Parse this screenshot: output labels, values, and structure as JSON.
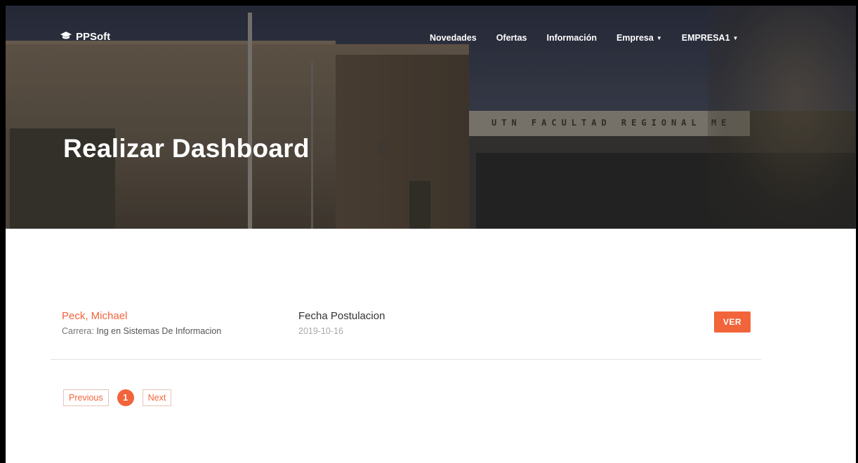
{
  "brand": {
    "name": "PPSoft",
    "icon": "graduation-cap-icon"
  },
  "nav": {
    "items": [
      {
        "label": "Novedades"
      },
      {
        "label": "Ofertas"
      },
      {
        "label": "Información"
      },
      {
        "label": "Empresa",
        "dropdown": true
      },
      {
        "label": "EMPRESA1",
        "dropdown": true
      }
    ]
  },
  "hero": {
    "title": "Realizar Dashboard",
    "sign_text": "UTN FACULTAD REGIONAL ME"
  },
  "postulacion": {
    "name": "Peck, Michael",
    "carrera_label": "Carrera:",
    "carrera_value": "Ing en Sistemas De Informacion",
    "fecha_label": "Fecha Postulacion",
    "fecha_value": "2019-10-16",
    "ver_label": "VER"
  },
  "pagination": {
    "previous": "Previous",
    "current": "1",
    "next": "Next"
  },
  "colors": {
    "accent": "#f2643a"
  }
}
